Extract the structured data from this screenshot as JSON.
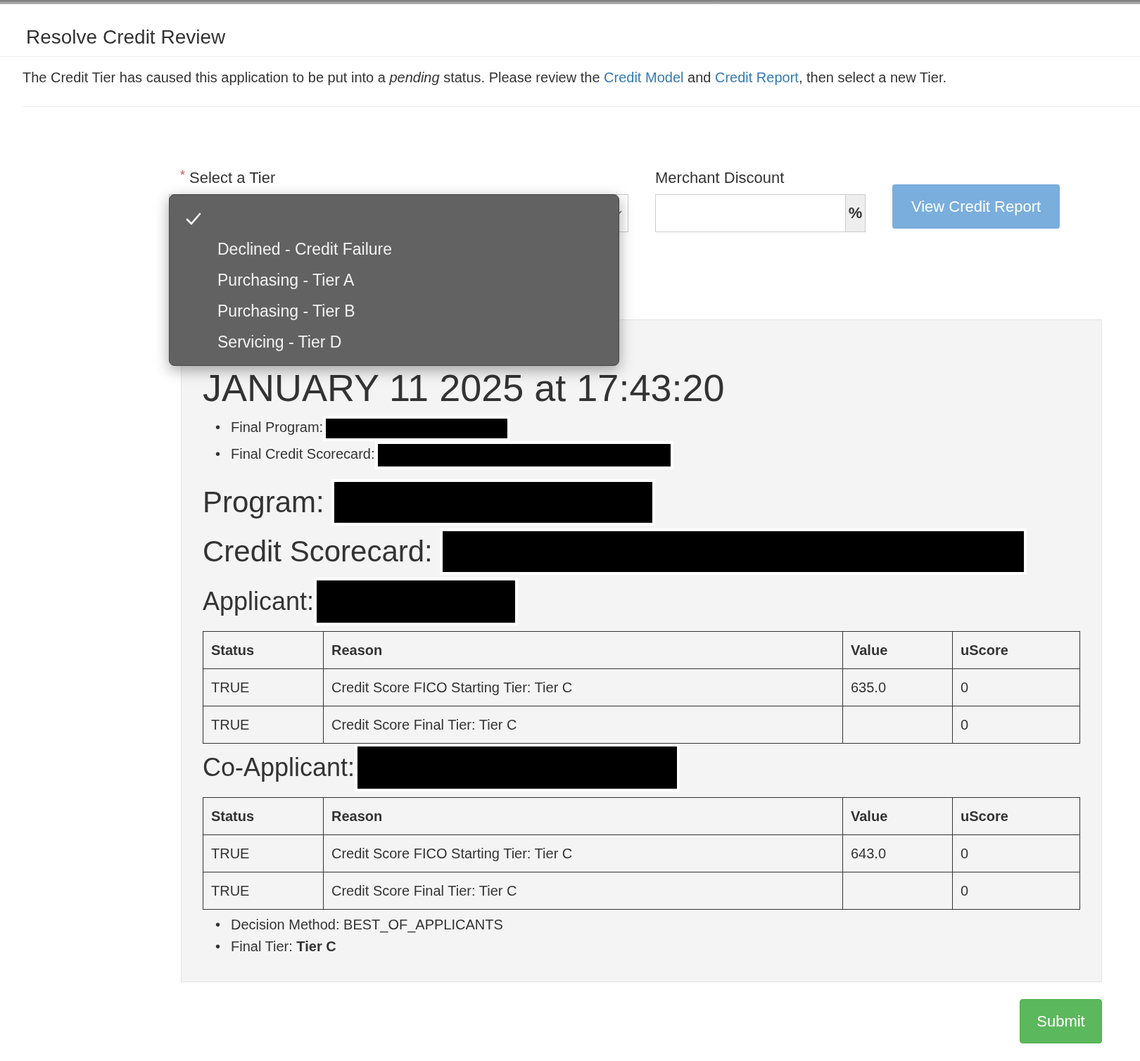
{
  "title": "Resolve Credit Review",
  "intro": {
    "before": "The Credit Tier has caused this application to be put into a *pending* status. Please review the",
    "link_1": "Credit Model",
    "middle": "and",
    "link_2": "Credit Report",
    "after": ", then select a new Tier."
  },
  "tier_select": {
    "required_mark": "*",
    "label": "Select a Tier",
    "expanded": true,
    "options": [
      {
        "selected": true
      },
      {
        "label": "Declined - Credit Failure",
        "selected": false
      },
      {
        "label": "Purchasing - Tier A",
        "selected": false
      },
      {
        "label": "Purchasing - Tier B",
        "selected": false
      },
      {
        "label": "Servicing - Tier D",
        "selected": false
      }
    ]
  },
  "merchant_discount": {
    "label": "Merchant Discount",
    "addon": "%"
  },
  "view_report_button": "View Credit Report",
  "model": {
    "date_heading": "JANUARY 11 2025 at 17:43:20",
    "summary": [
      {
        "bullet": "•",
        "label": "Final Program:"
      },
      {
        "bullet": "•",
        "label": "Final Credit Scorecard:"
      }
    ],
    "program_label": "Program:",
    "scorecard_label": "Credit Scorecard:",
    "applicants": [
      {
        "label": "Applicant:",
        "columns": [
          "Status",
          "Reason",
          "Value",
          "uScore"
        ],
        "rows": [
          [
            "TRUE",
            "Credit Score FICO Starting Tier: Tier C",
            "635.0",
            "0"
          ],
          [
            "TRUE",
            "Credit Score Final Tier: Tier C",
            "",
            "0"
          ]
        ]
      },
      {
        "label": "Co-Applicant:",
        "columns": [
          "Status",
          "Reason",
          "Value",
          "uScore"
        ],
        "rows": [
          [
            "TRUE",
            "Credit Score FICO Starting Tier: Tier C",
            "643.0",
            "0"
          ],
          [
            "TRUE",
            "Credit Score Final Tier: Tier C",
            "",
            "0"
          ]
        ]
      }
    ],
    "notes": [
      {
        "bullet": "•",
        "text": "Decision Method: BEST_OF_APPLICANTS"
      },
      {
        "bullet": "•",
        "text": "Final Tier: **Tier C**"
      }
    ]
  },
  "submit_button": "Submit"
}
